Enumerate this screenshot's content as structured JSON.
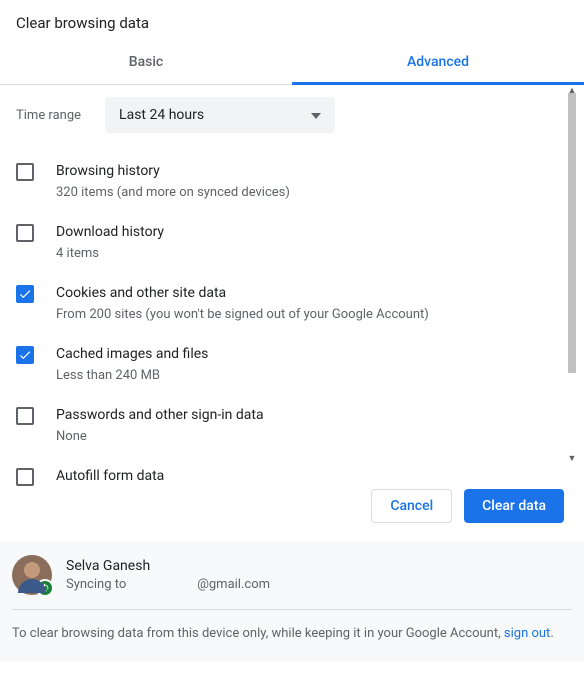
{
  "dialog_title": "Clear browsing data",
  "tabs": {
    "basic": "Basic",
    "advanced": "Advanced"
  },
  "time_range": {
    "label": "Time range",
    "value": "Last 24 hours"
  },
  "options": [
    {
      "checked": false,
      "title": "Browsing history",
      "sub": "320 items (and more on synced devices)"
    },
    {
      "checked": false,
      "title": "Download history",
      "sub": "4 items"
    },
    {
      "checked": true,
      "title": "Cookies and other site data",
      "sub": "From 200 sites (you won't be signed out of your Google Account)"
    },
    {
      "checked": true,
      "title": "Cached images and files",
      "sub": "Less than 240 MB"
    },
    {
      "checked": false,
      "title": "Passwords and other sign-in data",
      "sub": "None"
    },
    {
      "checked": false,
      "title": "Autofill form data",
      "sub": ""
    }
  ],
  "buttons": {
    "cancel": "Cancel",
    "clear": "Clear data"
  },
  "account": {
    "name": "Selva Ganesh",
    "sync_prefix": "Syncing to ",
    "email": "@gmail.com"
  },
  "note": {
    "text_before": "To clear browsing data from this device only, while keeping it in your Google Account, ",
    "link": "sign out",
    "text_after": "."
  }
}
